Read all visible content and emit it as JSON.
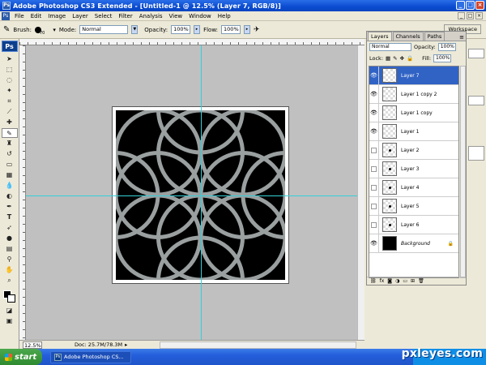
{
  "window": {
    "title": "Adobe Photoshop CS3 Extended - [Untitled-1 @ 12.5% (Layer 7, RGB/8)]",
    "ps_logo": "Ps"
  },
  "menu": [
    "File",
    "Edit",
    "Image",
    "Layer",
    "Select",
    "Filter",
    "Analysis",
    "View",
    "Window",
    "Help"
  ],
  "options": {
    "brush_label": "Brush:",
    "brush_size": "70",
    "mode_label": "Mode:",
    "mode_value": "Normal",
    "opacity_label": "Opacity:",
    "opacity_value": "100%",
    "flow_label": "Flow:",
    "flow_value": "100%",
    "workspace_label": "Workspace"
  },
  "toolbox": {
    "badge": "Ps",
    "tools": [
      "move-icon",
      "marquee-icon",
      "lasso-icon",
      "magic-wand-icon",
      "crop-icon",
      "slice-icon",
      "healing-icon",
      "brush-icon",
      "stamp-icon",
      "history-brush-icon",
      "eraser-icon",
      "gradient-icon",
      "blur-icon",
      "dodge-icon",
      "pen-icon",
      "type-icon",
      "path-select-icon",
      "shape-icon",
      "notes-icon",
      "eyedropper-icon",
      "hand-icon",
      "zoom-icon"
    ],
    "selected_tool": "brush-icon",
    "foreground_color": "#000000",
    "background_color": "#ffffff"
  },
  "status": {
    "zoom": "12.5%",
    "doc_info": "Doc: 25.7M/78.3M"
  },
  "layers_panel": {
    "tabs": [
      "Layers",
      "Channels",
      "Paths"
    ],
    "active_tab": "Layers",
    "blend_mode": "Normal",
    "opacity_label": "Opacity:",
    "opacity_value": "100%",
    "lock_label": "Lock:",
    "fill_label": "Fill:",
    "fill_value": "100%",
    "layers": [
      {
        "name": "Layer 7",
        "visible": true,
        "selected": true,
        "thumb": "empty"
      },
      {
        "name": "Layer 1 copy 2",
        "visible": true,
        "selected": false,
        "thumb": "empty"
      },
      {
        "name": "Layer 1 copy",
        "visible": true,
        "selected": false,
        "thumb": "empty"
      },
      {
        "name": "Layer 1",
        "visible": true,
        "selected": false,
        "thumb": "empty"
      },
      {
        "name": "Layer 2",
        "visible": false,
        "selected": false,
        "thumb": "dot"
      },
      {
        "name": "Layer 3",
        "visible": false,
        "selected": false,
        "thumb": "dot"
      },
      {
        "name": "Layer 4",
        "visible": false,
        "selected": false,
        "thumb": "dot"
      },
      {
        "name": "Layer 5",
        "visible": false,
        "selected": false,
        "thumb": "dot"
      },
      {
        "name": "Layer 6",
        "visible": false,
        "selected": false,
        "thumb": "dot"
      },
      {
        "name": "Background",
        "visible": true,
        "selected": false,
        "thumb": "black",
        "locked": true
      }
    ]
  },
  "canvas": {
    "background": "#000000",
    "ring_color": "#9a9fa0",
    "guide_color": "#35d0d8"
  },
  "taskbar": {
    "start_label": "start",
    "task_label": "Adobe Photoshop CS...",
    "watermark": "pxleyes.com"
  }
}
